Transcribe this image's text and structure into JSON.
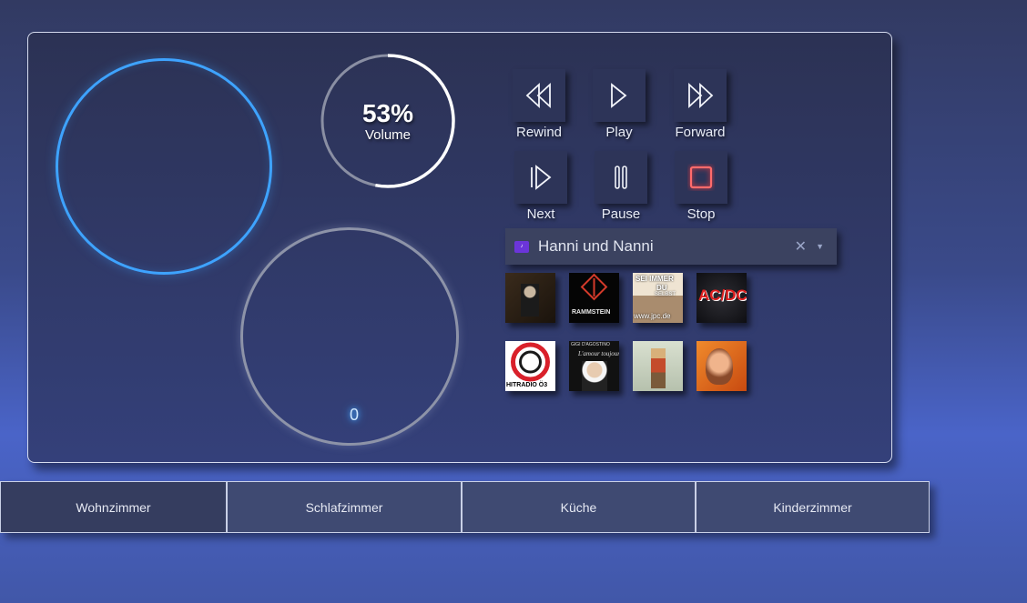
{
  "volume": {
    "percent_text": "53%",
    "label": "Volume",
    "level": 0.53
  },
  "dial": {
    "value": "0"
  },
  "controls": [
    {
      "label": "Rewind",
      "icon": "rewind-icon"
    },
    {
      "label": "Play",
      "icon": "play-icon"
    },
    {
      "label": "Forward",
      "icon": "forward-icon"
    },
    {
      "label": "Next",
      "icon": "next-icon"
    },
    {
      "label": "Pause",
      "icon": "pause-icon"
    },
    {
      "label": "Stop",
      "icon": "stop-icon"
    }
  ],
  "source_select": {
    "value": "Hanni und Nanni",
    "icon": "music-service-icon"
  },
  "covers": {
    "rammstein": "RAMMSTEIN",
    "sei_immer": "SEI IMMER",
    "du": "DU",
    "selbst": "SELBST",
    "site": "www.jpc.de",
    "acdc": "AC/DC",
    "hitradio": "HITRADIO Ö3",
    "gigi": "GIGI D'AGOSTINO",
    "gigi_title": "L'amour toujours"
  },
  "tabs": [
    "Wohnzimmer",
    "Schlafzimmer",
    "Küche",
    "Kinderzimmer"
  ],
  "colors": {
    "accent": "#3ea3ff",
    "stop": "#ff5a5a",
    "select_icon": "#6b35d9"
  }
}
